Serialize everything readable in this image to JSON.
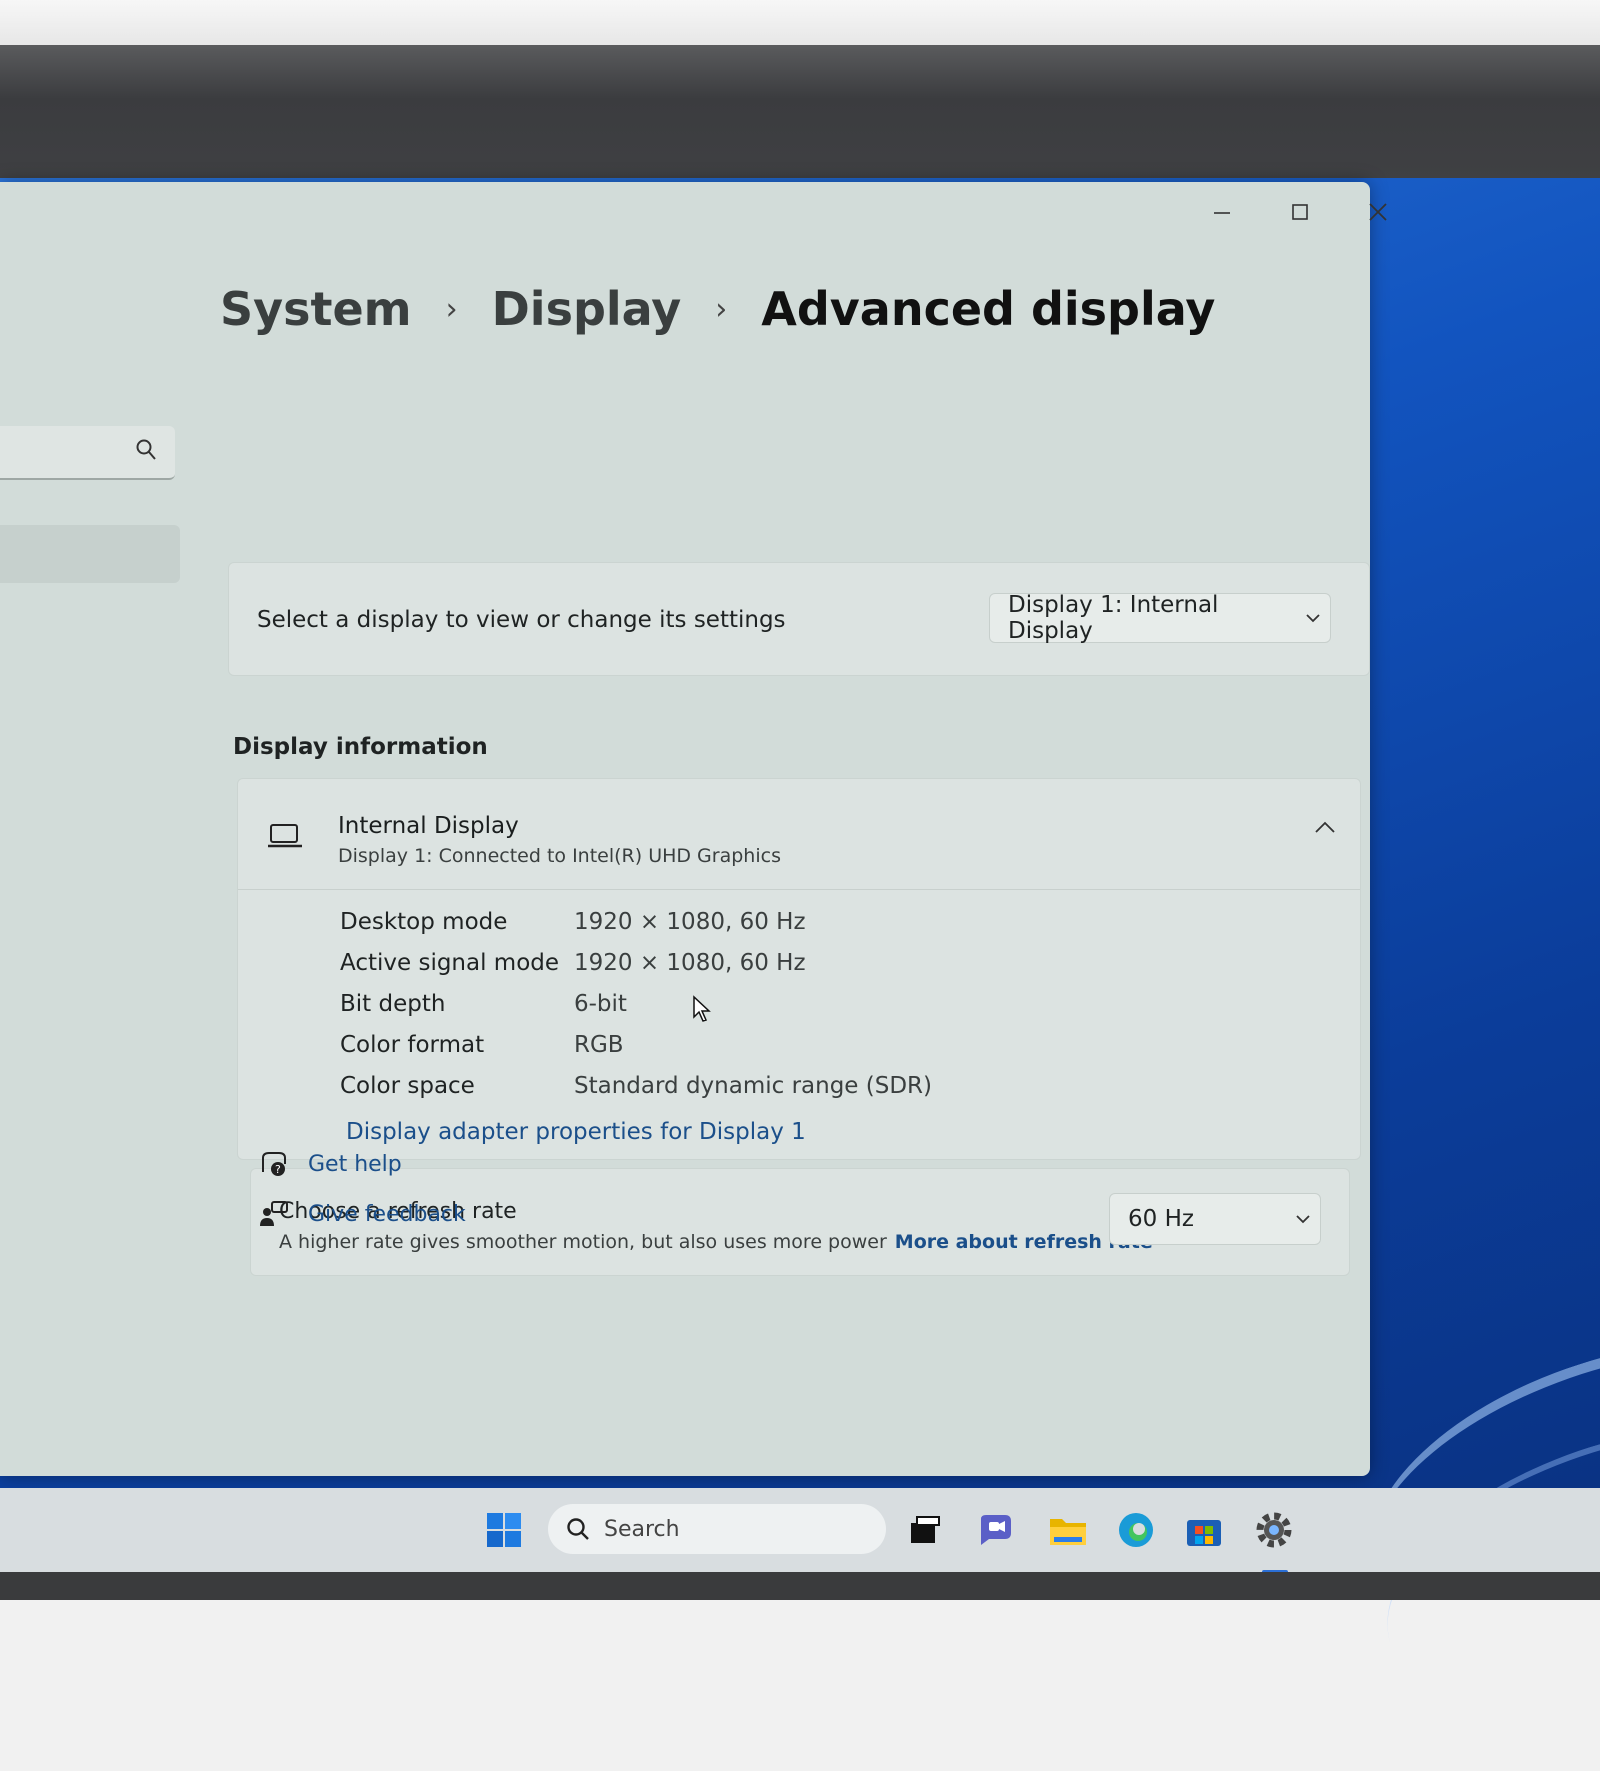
{
  "breadcrumb": {
    "level1": "System",
    "level2": "Display",
    "current": "Advanced display",
    "separator": "›"
  },
  "display_select": {
    "label": "Select a display to view or change its settings",
    "selected": "Display 1: Internal Display"
  },
  "display_info": {
    "section_title": "Display information",
    "device_name": "Internal Display",
    "device_sub": "Display 1: Connected to Intel(R) UHD Graphics",
    "properties": [
      {
        "label": "Desktop mode",
        "value": "1920 × 1080, 60 Hz"
      },
      {
        "label": "Active signal mode",
        "value": "1920 × 1080, 60 Hz"
      },
      {
        "label": "Bit depth",
        "value": "6-bit"
      },
      {
        "label": "Color format",
        "value": "RGB"
      },
      {
        "label": "Color space",
        "value": "Standard dynamic range (SDR)"
      }
    ],
    "adapter_link": "Display adapter properties for Display 1"
  },
  "refresh": {
    "title": "Choose a refresh rate",
    "description": "A higher rate gives smoother motion, but also uses more power",
    "more_link": "More about refresh rate",
    "selected": "60 Hz"
  },
  "help": {
    "get_help": "Get help",
    "give_feedback": "Give feedback"
  },
  "taskbar": {
    "search_placeholder": "Search"
  },
  "icons": {
    "search": "search-icon",
    "laptop": "laptop-icon",
    "collapse": "chevron-up-icon",
    "dropdown": "chevron-down-icon",
    "help": "help-icon",
    "feedback": "feedback-icon"
  },
  "colors": {
    "accent": "#1b4f8a",
    "window_bg": "#d2dcd9",
    "taskbar_bg": "#d8dde0",
    "wallpaper": "#1254bf"
  }
}
